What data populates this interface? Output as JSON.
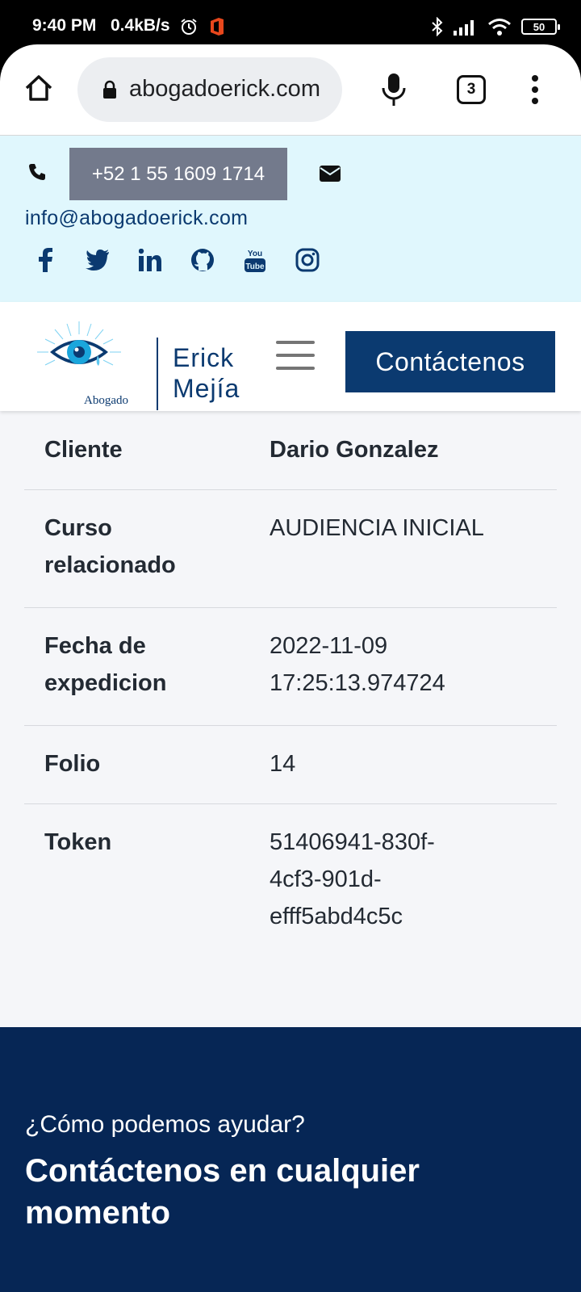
{
  "status_bar": {
    "time": "9:40 PM",
    "net_speed": "0.4kB/s",
    "battery": "50"
  },
  "browser": {
    "url": "abogadoerick.com",
    "tab_count": "3"
  },
  "topbar": {
    "phone": "+52 1 55 1609 1714",
    "email": "info@abogadoerick.com",
    "socials": [
      "facebook-icon",
      "twitter-icon",
      "linkedin-icon",
      "github-icon",
      "youtube-icon",
      "instagram-icon"
    ]
  },
  "header": {
    "logo_name_line1": "Erick",
    "logo_name_line2": "Mejía",
    "logo_sub": "Abogado",
    "cta": "Contáctenos"
  },
  "certificate": {
    "rows": [
      {
        "key": [
          "Cliente"
        ],
        "value": [
          "Dario Gonzalez"
        ]
      },
      {
        "key": [
          "Curso",
          "relacionado"
        ],
        "value": [
          "AUDIENCIA INICIAL"
        ]
      },
      {
        "key": [
          "Fecha de",
          "expedicion"
        ],
        "value": [
          "2022-11-09",
          "17:25:13.974724"
        ]
      },
      {
        "key": [
          "Folio"
        ],
        "value": [
          "14"
        ]
      },
      {
        "key": [
          "Token"
        ],
        "value": [
          "51406941-830f-",
          "4cf3-901d-",
          "efff5abd4c5c"
        ]
      }
    ]
  },
  "footer": {
    "subtitle": "¿Cómo podemos ayudar?",
    "title_line1": "Contáctenos en cualquier",
    "title_line2": "momento"
  },
  "colors": {
    "brand_navy": "#0b3a70",
    "footer_bg": "#062655",
    "topbar_bg": "#e0f7fd",
    "phone_btn": "#737a8c"
  }
}
